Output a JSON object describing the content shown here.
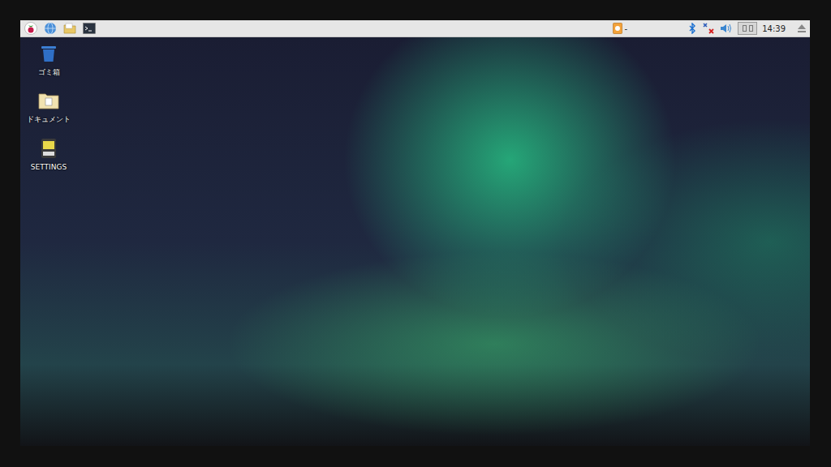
{
  "taskbar": {
    "launchers": [
      {
        "kind": "menu"
      },
      {
        "kind": "browser"
      },
      {
        "kind": "files"
      },
      {
        "kind": "terminal"
      }
    ],
    "tray": {
      "update_indicator": "-",
      "network_connected": false,
      "clock": "14:39"
    }
  },
  "desktop": {
    "icons": [
      {
        "label": "ゴミ箱",
        "kind": "trash"
      },
      {
        "label": "ドキュメント",
        "kind": "folder"
      },
      {
        "label": "SETTINGS",
        "kind": "drive"
      }
    ]
  }
}
